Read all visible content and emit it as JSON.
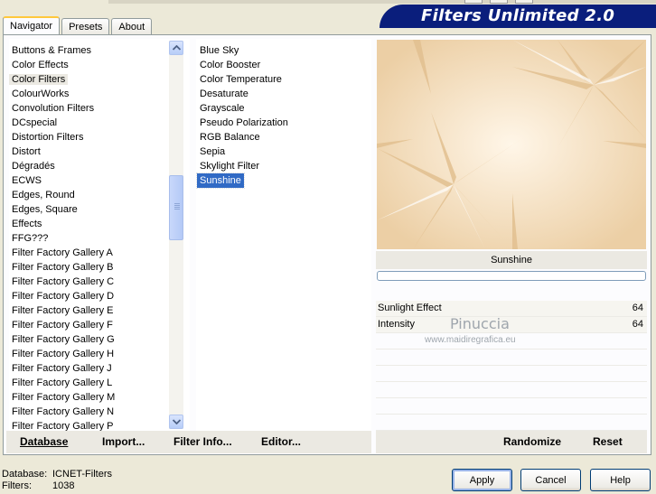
{
  "app": {
    "title": "Filters Unlimited 2.0"
  },
  "tabs": [
    {
      "label": "Navigator",
      "active": true
    },
    {
      "label": "Presets",
      "active": false
    },
    {
      "label": "About",
      "active": false
    }
  ],
  "categories": {
    "selected": "Color Filters",
    "items": [
      "Buttons & Frames",
      "Color Effects",
      "Color Filters",
      "ColourWorks",
      "Convolution Filters",
      "DCspecial",
      "Distortion Filters",
      "Distort",
      "Dégradés",
      "ECWS",
      "Edges, Round",
      "Edges, Square",
      "Effects",
      "FFG???",
      "Filter Factory Gallery A",
      "Filter Factory Gallery B",
      "Filter Factory Gallery C",
      "Filter Factory Gallery D",
      "Filter Factory Gallery E",
      "Filter Factory Gallery F",
      "Filter Factory Gallery G",
      "Filter Factory Gallery H",
      "Filter Factory Gallery J",
      "Filter Factory Gallery L",
      "Filter Factory Gallery M",
      "Filter Factory Gallery N",
      "Filter Factory Gallery P"
    ]
  },
  "filters": {
    "selected": "Sunshine",
    "items": [
      "Blue Sky",
      "Color Booster",
      "Color Temperature",
      "Desaturate",
      "Grayscale",
      "Pseudo Polarization",
      "RGB Balance",
      "Sepia",
      "Skylight Filter",
      "Sunshine"
    ]
  },
  "preview": {
    "filter_name": "Sunshine",
    "progress": 0
  },
  "parameters": [
    {
      "name": "Sunlight Effect",
      "value": "64"
    },
    {
      "name": "Intensity",
      "value": "64"
    },
    {
      "name": "",
      "value": ""
    },
    {
      "name": "",
      "value": ""
    },
    {
      "name": "",
      "value": ""
    },
    {
      "name": "",
      "value": ""
    },
    {
      "name": "",
      "value": ""
    },
    {
      "name": "",
      "value": ""
    }
  ],
  "left_actions": {
    "database": "Database",
    "import": "Import...",
    "filter_info": "Filter Info...",
    "editor": "Editor..."
  },
  "right_actions": {
    "randomize": "Randomize",
    "reset": "Reset"
  },
  "watermark": {
    "name": "Pinuccia",
    "url": "www.maidiregrafica.eu"
  },
  "status": {
    "database_label": "Database:",
    "database_value": "ICNET-Filters",
    "filters_label": "Filters:",
    "filters_value": "1038"
  },
  "dialog_buttons": {
    "apply": "Apply",
    "cancel": "Cancel",
    "help": "Help"
  },
  "colors": {
    "banner": "#0a1e7c",
    "selection": "#316ac5",
    "panel_bg": "#ece9d8",
    "tab_accent": "#ffc83c"
  }
}
